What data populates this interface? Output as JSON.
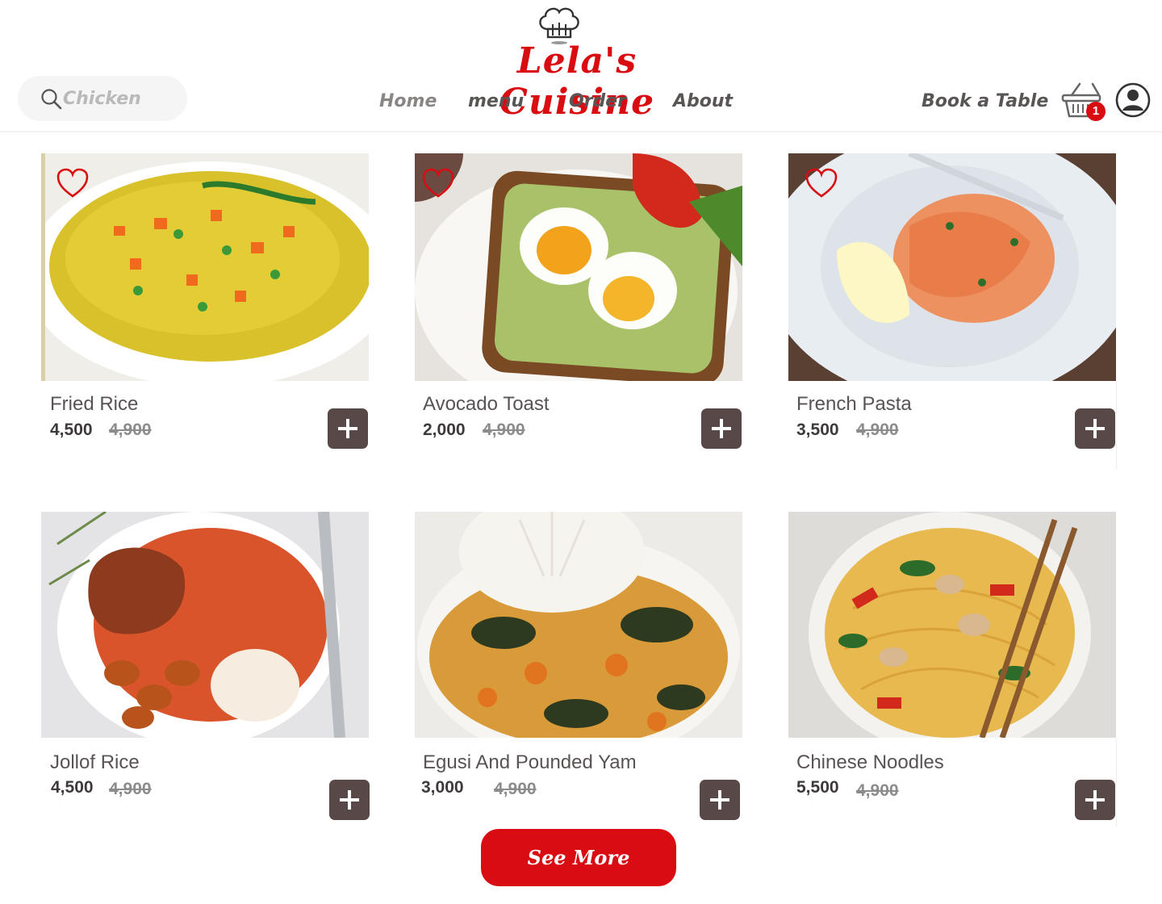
{
  "brand": {
    "name": "Lela's Cuisine"
  },
  "search": {
    "placeholder": "Chicken"
  },
  "nav": {
    "home": "Home",
    "menu": "menu",
    "order": "Order",
    "about": "About",
    "book": "Book a Table"
  },
  "cart": {
    "count": "1"
  },
  "menu_items": [
    {
      "name": "Fried Rice",
      "price": "4,500",
      "old_price": "4,900",
      "favorited": false
    },
    {
      "name": "Avocado Toast",
      "price": "2,000",
      "old_price": "4,900",
      "favorited": false
    },
    {
      "name": "French Pasta",
      "price": "3,500",
      "old_price": "4,900",
      "favorited": false
    },
    {
      "name": "Jollof Rice",
      "price": "4,500",
      "old_price": "4,900"
    },
    {
      "name": "Egusi And Pounded Yam",
      "price": "3,000",
      "old_price": "4,900"
    },
    {
      "name": "Chinese Noodles",
      "price": "5,500",
      "old_price": "4,900"
    }
  ],
  "see_more": {
    "label": "See More"
  },
  "colors": {
    "brand_red": "#d90c12",
    "add_button": "#594848",
    "heart": "#d90c12"
  },
  "icons": {
    "search": "search-icon",
    "cart": "basket-icon",
    "profile": "user-icon",
    "favorite": "heart-icon",
    "add": "plus-icon",
    "logo": "chef-hat-icon"
  }
}
